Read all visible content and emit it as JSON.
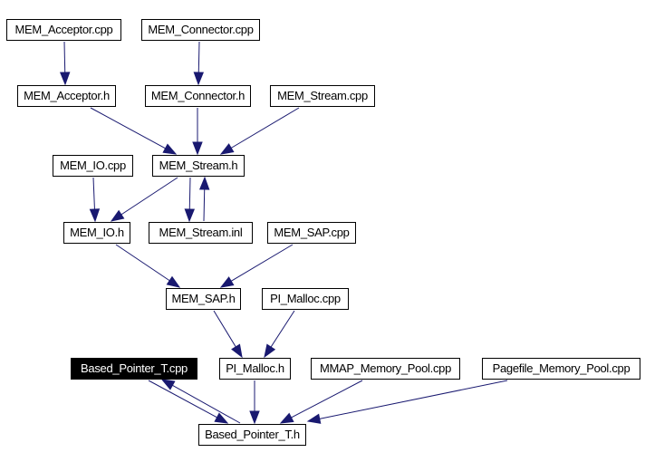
{
  "graph": {
    "edge_color": "#191970",
    "nodes": [
      {
        "id": "mem_acceptor_cpp",
        "label": "MEM_Acceptor.cpp"
      },
      {
        "id": "mem_connector_cpp",
        "label": "MEM_Connector.cpp"
      },
      {
        "id": "mem_acceptor_h",
        "label": "MEM_Acceptor.h"
      },
      {
        "id": "mem_connector_h",
        "label": "MEM_Connector.h"
      },
      {
        "id": "mem_stream_cpp",
        "label": "MEM_Stream.cpp"
      },
      {
        "id": "mem_io_cpp",
        "label": "MEM_IO.cpp"
      },
      {
        "id": "mem_stream_h",
        "label": "MEM_Stream.h"
      },
      {
        "id": "mem_io_h",
        "label": "MEM_IO.h"
      },
      {
        "id": "mem_stream_inl",
        "label": "MEM_Stream.inl"
      },
      {
        "id": "mem_sap_cpp",
        "label": "MEM_SAP.cpp"
      },
      {
        "id": "mem_sap_h",
        "label": "MEM_SAP.h"
      },
      {
        "id": "pi_malloc_cpp",
        "label": "PI_Malloc.cpp"
      },
      {
        "id": "based_pointer_t_cpp",
        "label": "Based_Pointer_T.cpp",
        "current": true
      },
      {
        "id": "pi_malloc_h",
        "label": "PI_Malloc.h"
      },
      {
        "id": "mmap_memory_pool_cpp",
        "label": "MMAP_Memory_Pool.cpp"
      },
      {
        "id": "pagefile_memory_pool_cpp",
        "label": "Pagefile_Memory_Pool.cpp"
      },
      {
        "id": "based_pointer_t_h",
        "label": "Based_Pointer_T.h"
      }
    ],
    "edges": [
      {
        "from": "mem_acceptor_cpp",
        "to": "mem_acceptor_h"
      },
      {
        "from": "mem_connector_cpp",
        "to": "mem_connector_h"
      },
      {
        "from": "mem_acceptor_h",
        "to": "mem_stream_h"
      },
      {
        "from": "mem_connector_h",
        "to": "mem_stream_h"
      },
      {
        "from": "mem_stream_cpp",
        "to": "mem_stream_h"
      },
      {
        "from": "mem_io_cpp",
        "to": "mem_io_h"
      },
      {
        "from": "mem_stream_h",
        "to": "mem_io_h"
      },
      {
        "from": "mem_stream_h",
        "to": "mem_stream_inl"
      },
      {
        "from": "mem_stream_inl",
        "to": "mem_stream_h"
      },
      {
        "from": "mem_io_h",
        "to": "mem_sap_h"
      },
      {
        "from": "mem_sap_cpp",
        "to": "mem_sap_h"
      },
      {
        "from": "mem_sap_h",
        "to": "pi_malloc_h"
      },
      {
        "from": "pi_malloc_cpp",
        "to": "pi_malloc_h"
      },
      {
        "from": "pi_malloc_h",
        "to": "based_pointer_t_h"
      },
      {
        "from": "based_pointer_t_cpp",
        "to": "based_pointer_t_h"
      },
      {
        "from": "based_pointer_t_h",
        "to": "based_pointer_t_cpp"
      },
      {
        "from": "mmap_memory_pool_cpp",
        "to": "based_pointer_t_h"
      },
      {
        "from": "pagefile_memory_pool_cpp",
        "to": "based_pointer_t_h"
      }
    ]
  }
}
